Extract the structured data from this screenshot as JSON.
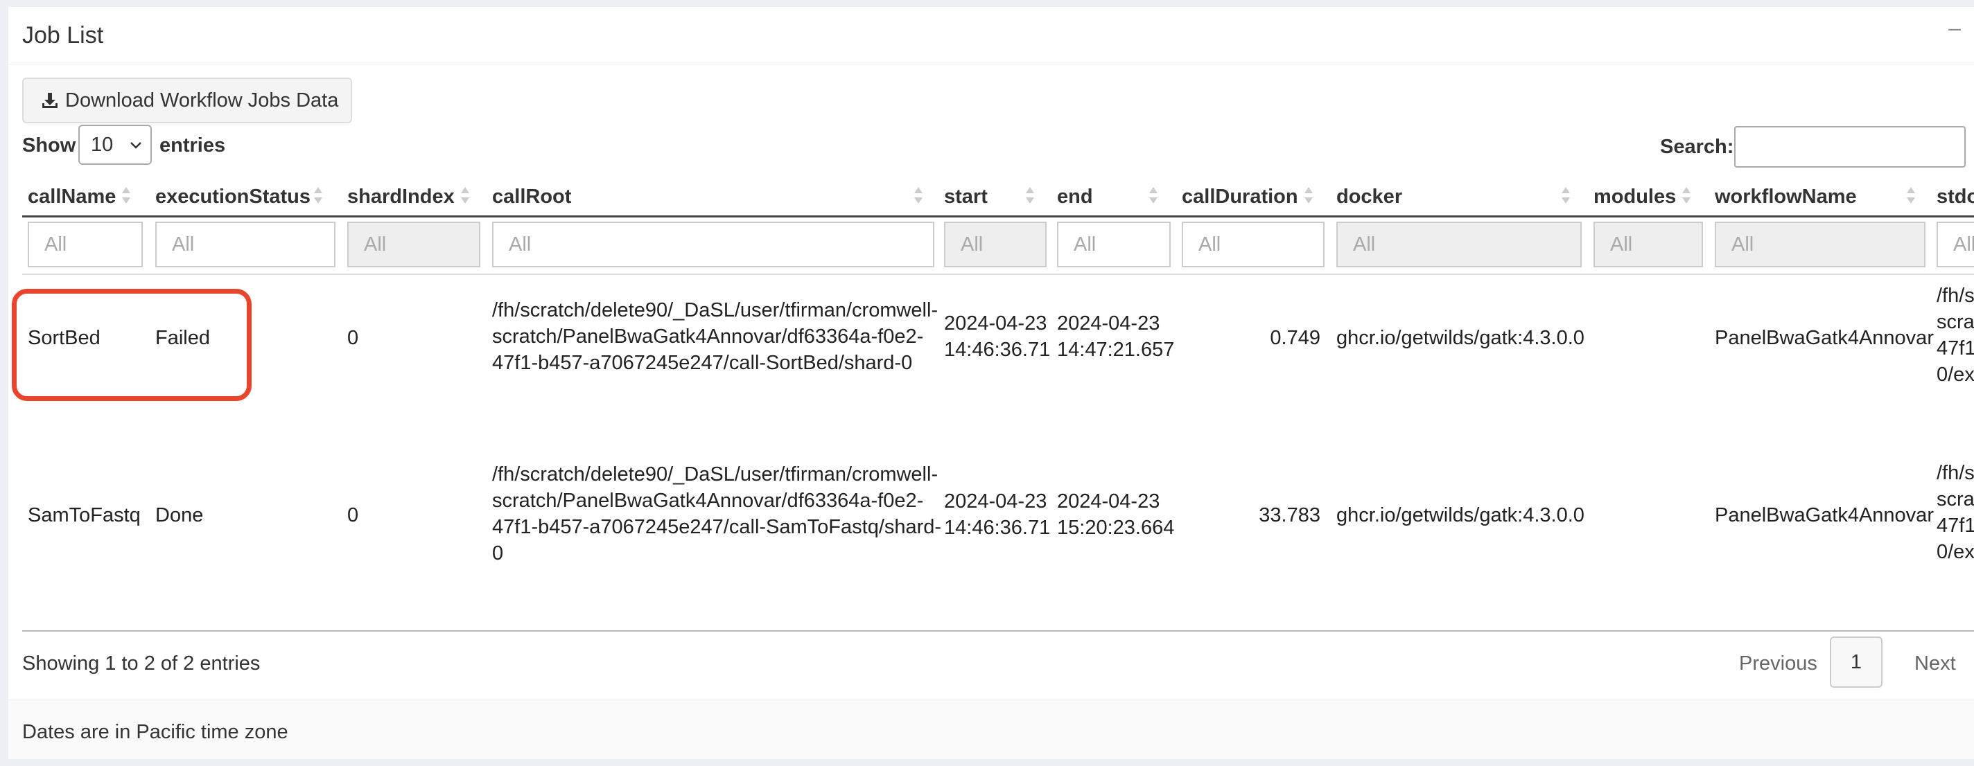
{
  "panel": {
    "title": "Job List",
    "minimize_glyph": "–"
  },
  "toolbar": {
    "download_label": "Download Workflow Jobs Data",
    "download_icon": "download-icon"
  },
  "length": {
    "show_label": "Show",
    "value": "10",
    "entries_label": "entries"
  },
  "search": {
    "label": "Search:",
    "value": ""
  },
  "table": {
    "columns": [
      {
        "label": "callName"
      },
      {
        "label": "executionStatus"
      },
      {
        "label": "shardIndex"
      },
      {
        "label": "callRoot"
      },
      {
        "label": "start"
      },
      {
        "label": "end"
      },
      {
        "label": "callDuration"
      },
      {
        "label": "docker"
      },
      {
        "label": "modules"
      },
      {
        "label": "workflowName"
      },
      {
        "label": "stdo"
      }
    ],
    "filter_placeholder": "All",
    "rows": [
      {
        "callName": "SortBed",
        "executionStatus": "Failed",
        "shardIndex": "0",
        "callRoot": [
          "/fh/scratch/delete90/_DaSL/user/tfirman/cromwell-",
          "scratch/PanelBwaGatk4Annovar/df63364a-f0e2-",
          "47f1-b457-a7067245e247/call-SortBed/shard-0"
        ],
        "start": [
          "2024-04-23",
          "14:46:36.71"
        ],
        "end": [
          "2024-04-23",
          "14:47:21.657"
        ],
        "callDuration": "0.749",
        "docker": "ghcr.io/getwilds/gatk:4.3.0.0",
        "modules": "",
        "workflowName": "PanelBwaGatk4Annovar",
        "stdout": [
          "/fh/s",
          "scra",
          "47f1",
          "0/ex"
        ]
      },
      {
        "callName": "SamToFastq",
        "executionStatus": "Done",
        "shardIndex": "0",
        "callRoot": [
          "/fh/scratch/delete90/_DaSL/user/tfirman/cromwell-",
          "scratch/PanelBwaGatk4Annovar/df63364a-f0e2-",
          "47f1-b457-a7067245e247/call-SamToFastq/shard-",
          "0"
        ],
        "start": [
          "2024-04-23",
          "14:46:36.71"
        ],
        "end": [
          "2024-04-23",
          "15:20:23.664"
        ],
        "callDuration": "33.783",
        "docker": "ghcr.io/getwilds/gatk:4.3.0.0",
        "modules": "",
        "workflowName": "PanelBwaGatk4Annovar",
        "stdout": [
          "/fh/s",
          "scra",
          "47f1",
          "0/ex"
        ]
      }
    ]
  },
  "pagination": {
    "info": "Showing 1 to 2 of 2 entries",
    "previous": "Previous",
    "current": "1",
    "next": "Next"
  },
  "footer": {
    "note": "Dates are in Pacific time zone"
  },
  "colors": {
    "highlight": "#e8452e"
  }
}
